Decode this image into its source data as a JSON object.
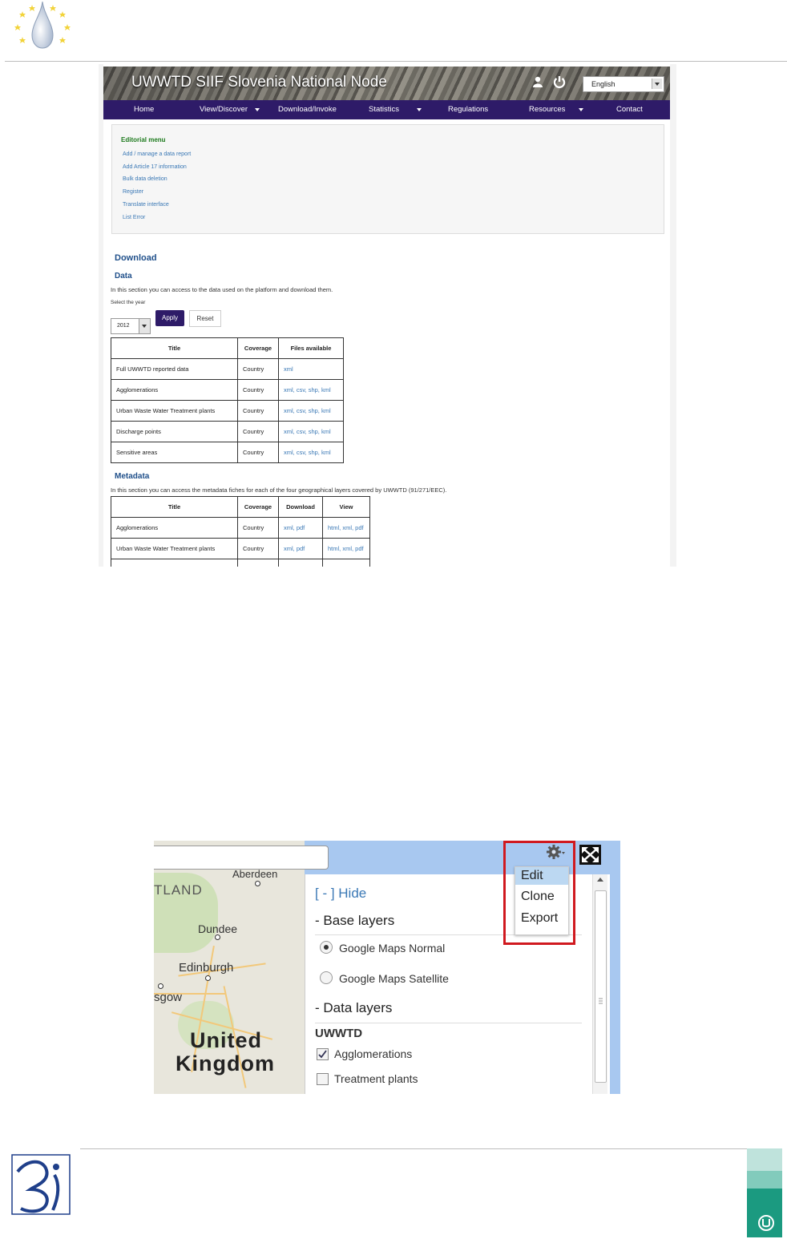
{
  "site": {
    "banner_title": "UWWTD SIIF Slovenia National Node",
    "language": "English",
    "nav": [
      "Home",
      "View/Discover",
      "Download/Invoke",
      "Statistics",
      "Regulations",
      "Resources",
      "Contact"
    ]
  },
  "editorial": {
    "title": "Editorial menu",
    "links": [
      "Add / manage a data report",
      "Add Article 17 information",
      "Bulk data deletion",
      "Register",
      "Translate interface",
      "List Error"
    ]
  },
  "download": {
    "heading": "Download",
    "data_heading": "Data",
    "data_intro": "In this section you can access to the data used on the platform and download them.",
    "select_year_label": "Select the year",
    "year": "2012",
    "apply": "Apply",
    "reset": "Reset",
    "data_table": {
      "headers": [
        "Title",
        "Coverage",
        "Files available"
      ],
      "rows": [
        [
          "Full UWWTD reported data",
          "Country",
          "xml"
        ],
        [
          "Agglomerations",
          "Country",
          "xml, csv, shp, kml"
        ],
        [
          "Urban Waste Water Treatment plants",
          "Country",
          "xml, csv, shp, kml"
        ],
        [
          "Discharge points",
          "Country",
          "xml, csv, shp, kml"
        ],
        [
          "Sensitive areas",
          "Country",
          "xml, csv, shp, kml"
        ]
      ]
    },
    "metadata_heading": "Metadata",
    "metadata_intro": "In this section you can access the metadata fiches for each of the four geographical layers covered by UWWTD (91/271/EEC).",
    "meta_table": {
      "headers": [
        "Title",
        "Coverage",
        "Download",
        "View"
      ],
      "rows": [
        [
          "Agglomerations",
          "Country",
          "xml, pdf",
          "html, xml, pdf"
        ],
        [
          "Urban Waste Water Treatment plants",
          "Country",
          "xml, pdf",
          "html, xml, pdf"
        ]
      ]
    }
  },
  "map_view": {
    "labels": [
      "Aberdeen",
      "TLAND",
      "Dundee",
      "Edinburgh",
      "sgow",
      "United",
      "Kingdom"
    ],
    "hide_link": "[ - ] Hide",
    "base_layers_heading": "-  Base layers",
    "base_layers": [
      {
        "label": "Google Maps Normal",
        "selected": true
      },
      {
        "label": "Google Maps Satellite",
        "selected": false
      }
    ],
    "data_layers_heading": "-  Data layers",
    "group": "UWWTD",
    "data_layers": [
      {
        "label": "Agglomerations",
        "checked": true
      },
      {
        "label": "Treatment plants",
        "checked": false
      }
    ],
    "gear_menu": [
      "Edit",
      "Clone",
      "Export"
    ],
    "highlight_color": "#d0191f"
  }
}
